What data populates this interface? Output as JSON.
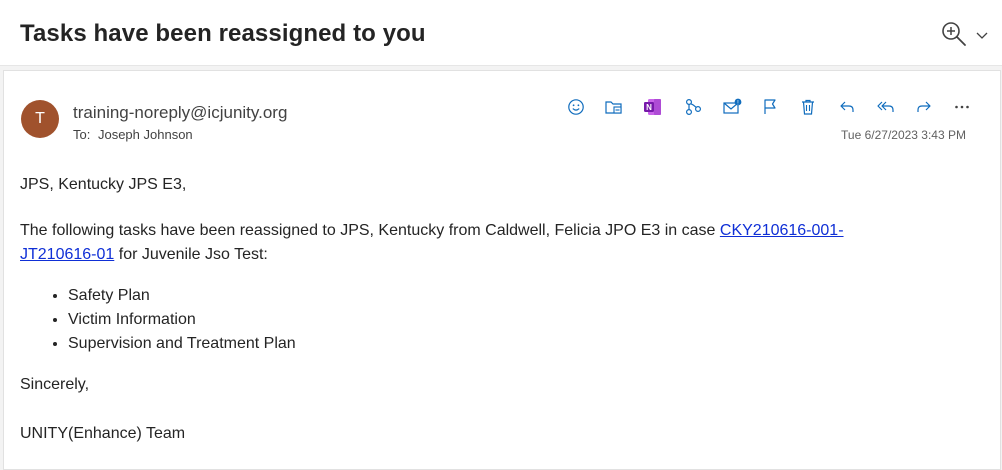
{
  "subject": "Tasks have been reassigned to you",
  "message": {
    "avatar_initial": "T",
    "from": "training-noreply@icjunity.org",
    "to_label": "To:",
    "to_name": "Joseph Johnson",
    "timestamp": "Tue 6/27/2023 3:43 PM",
    "greeting": "JPS, Kentucky JPS E3,",
    "intro_before": "The following tasks have been reassigned to JPS, Kentucky from Caldwell, Felicia JPO E3 in case ",
    "case_link_line1": "CKY210616-001-",
    "case_link_line2": "JT210616-01",
    "intro_after": " for Juvenile Jso Test:",
    "tasks": [
      "Safety Plan",
      "Victim Information",
      "Supervision and Treatment Plan"
    ],
    "closing": "Sincerely,",
    "signature": "UNITY(Enhance) Team"
  },
  "toolbar_icons": [
    "emoji-icon",
    "move-to-folder-icon",
    "onenote-icon",
    "share-icon",
    "mark-unread-icon",
    "flag-icon",
    "delete-icon",
    "reply-icon",
    "reply-all-icon",
    "forward-icon",
    "more-icon"
  ],
  "colors": {
    "accent": "#0f6cbd",
    "avatar": "#a0522d",
    "link": "#0f2fd6",
    "onenote": "#7719aa"
  }
}
